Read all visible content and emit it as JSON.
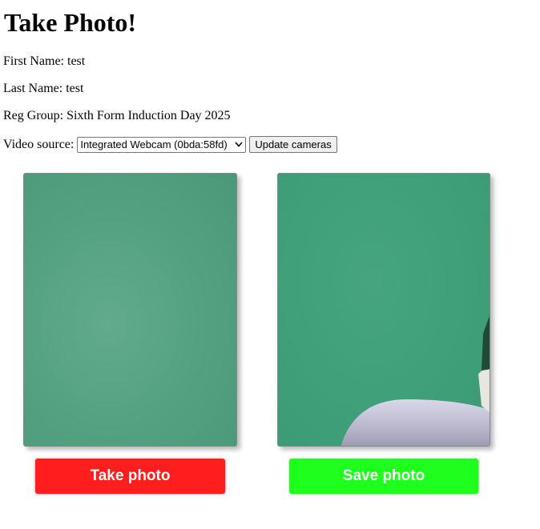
{
  "page": {
    "title": "Take Photo!"
  },
  "student": {
    "first_name_label": "First Name:",
    "first_name": "test",
    "last_name_label": "Last Name:",
    "last_name": "test",
    "reg_group_label": "Reg Group:",
    "reg_group": "Sixth Form Induction Day 2025"
  },
  "camera": {
    "source_label": "Video source:",
    "selected_source": "Integrated Webcam (0bda:58fd)",
    "update_label": "Update cameras"
  },
  "actions": {
    "take_label": "Take photo",
    "save_label": "Save photo"
  },
  "colors": {
    "take_button": "#ff1e1e",
    "save_button": "#1eff1e",
    "video_feed": "#55a281",
    "captured_photo": "#3f9f78"
  },
  "icons": {
    "select_arrow": "chevron-down-icon"
  }
}
